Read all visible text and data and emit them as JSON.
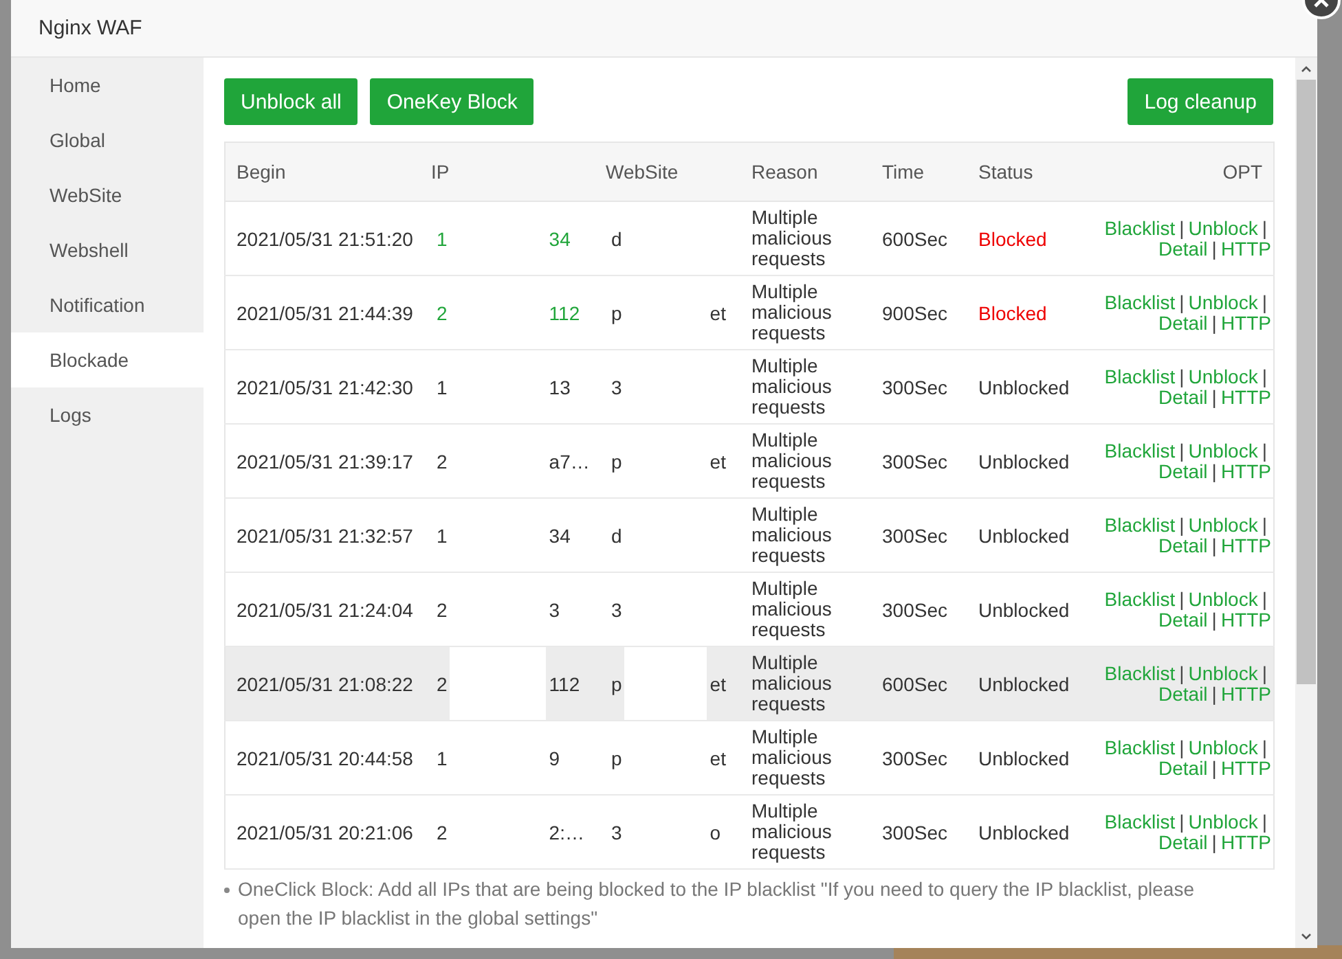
{
  "window": {
    "title": "Nginx WAF"
  },
  "sidebar": {
    "items": [
      {
        "label": "Home",
        "selected": false
      },
      {
        "label": "Global",
        "selected": false
      },
      {
        "label": "WebSite",
        "selected": false
      },
      {
        "label": "Webshell",
        "selected": false
      },
      {
        "label": "Notification",
        "selected": false
      },
      {
        "label": "Blockade",
        "selected": true
      },
      {
        "label": "Logs",
        "selected": false
      }
    ]
  },
  "toolbar": {
    "left_buttons": [
      "Unblock all",
      "OneKey Block"
    ],
    "right_buttons": [
      "Log cleanup"
    ]
  },
  "table": {
    "columns": [
      "Begin",
      "IP",
      "WebSite",
      "Reason",
      "Time",
      "Status",
      "OPT"
    ],
    "separator": "|",
    "rows": [
      {
        "begin": "2021/05/31 21:51:20",
        "ip_start": "1",
        "ip_end": "34",
        "site_start": "d",
        "site_end": "",
        "reason": "Multiple malicious requests",
        "time": "600Sec",
        "status": "Blocked",
        "blocked": true,
        "highlighted": false,
        "actions": [
          "Blacklist",
          "Unblock",
          "Detail",
          "HTTP"
        ]
      },
      {
        "begin": "2021/05/31 21:44:39",
        "ip_start": "2",
        "ip_end": "112",
        "site_start": "p",
        "site_end": "et",
        "reason": "Multiple malicious requests",
        "time": "900Sec",
        "status": "Blocked",
        "blocked": true,
        "highlighted": false,
        "actions": [
          "Blacklist",
          "Unblock",
          "Detail",
          "HTTP"
        ]
      },
      {
        "begin": "2021/05/31 21:42:30",
        "ip_start": "1",
        "ip_end": "13",
        "site_start": "3",
        "site_end": "",
        "reason": "Multiple malicious requests",
        "time": "300Sec",
        "status": "Unblocked",
        "blocked": false,
        "highlighted": false,
        "actions": [
          "Blacklist",
          "Unblock",
          "Detail",
          "HTTP"
        ]
      },
      {
        "begin": "2021/05/31 21:39:17",
        "ip_start": "2",
        "ip_end": "a7…",
        "site_start": "p",
        "site_end": "et",
        "reason": "Multiple malicious requests",
        "time": "300Sec",
        "status": "Unblocked",
        "blocked": false,
        "highlighted": false,
        "actions": [
          "Blacklist",
          "Unblock",
          "Detail",
          "HTTP"
        ]
      },
      {
        "begin": "2021/05/31 21:32:57",
        "ip_start": "1",
        "ip_end": "34",
        "site_start": "d",
        "site_end": "",
        "reason": "Multiple malicious requests",
        "time": "300Sec",
        "status": "Unblocked",
        "blocked": false,
        "highlighted": false,
        "actions": [
          "Blacklist",
          "Unblock",
          "Detail",
          "HTTP"
        ]
      },
      {
        "begin": "2021/05/31 21:24:04",
        "ip_start": "2",
        "ip_end": "3",
        "site_start": "3",
        "site_end": "",
        "reason": "Multiple malicious requests",
        "time": "300Sec",
        "status": "Unblocked",
        "blocked": false,
        "highlighted": false,
        "actions": [
          "Blacklist",
          "Unblock",
          "Detail",
          "HTTP"
        ]
      },
      {
        "begin": "2021/05/31 21:08:22",
        "ip_start": "2",
        "ip_end": "112",
        "site_start": "p",
        "site_end": "et",
        "reason": "Multiple malicious requests",
        "time": "600Sec",
        "status": "Unblocked",
        "blocked": false,
        "highlighted": true,
        "actions": [
          "Blacklist",
          "Unblock",
          "Detail",
          "HTTP"
        ]
      },
      {
        "begin": "2021/05/31 20:44:58",
        "ip_start": "1",
        "ip_end": "9",
        "site_start": "p",
        "site_end": "et",
        "reason": "Multiple malicious requests",
        "time": "300Sec",
        "status": "Unblocked",
        "blocked": false,
        "highlighted": false,
        "actions": [
          "Blacklist",
          "Unblock",
          "Detail",
          "HTTP"
        ]
      },
      {
        "begin": "2021/05/31 20:21:06",
        "ip_start": "2",
        "ip_end": "2:…",
        "site_start": "3",
        "site_end": "o",
        "reason": "Multiple malicious requests",
        "time": "300Sec",
        "status": "Unblocked",
        "blocked": false,
        "highlighted": false,
        "actions": [
          "Blacklist",
          "Unblock",
          "Detail",
          "HTTP"
        ]
      }
    ]
  },
  "tip": "OneClick Block: Add all IPs that are being blocked to the IP blacklist \"If you need to query the IP blacklist, please open the IP blacklist in the global settings\""
}
